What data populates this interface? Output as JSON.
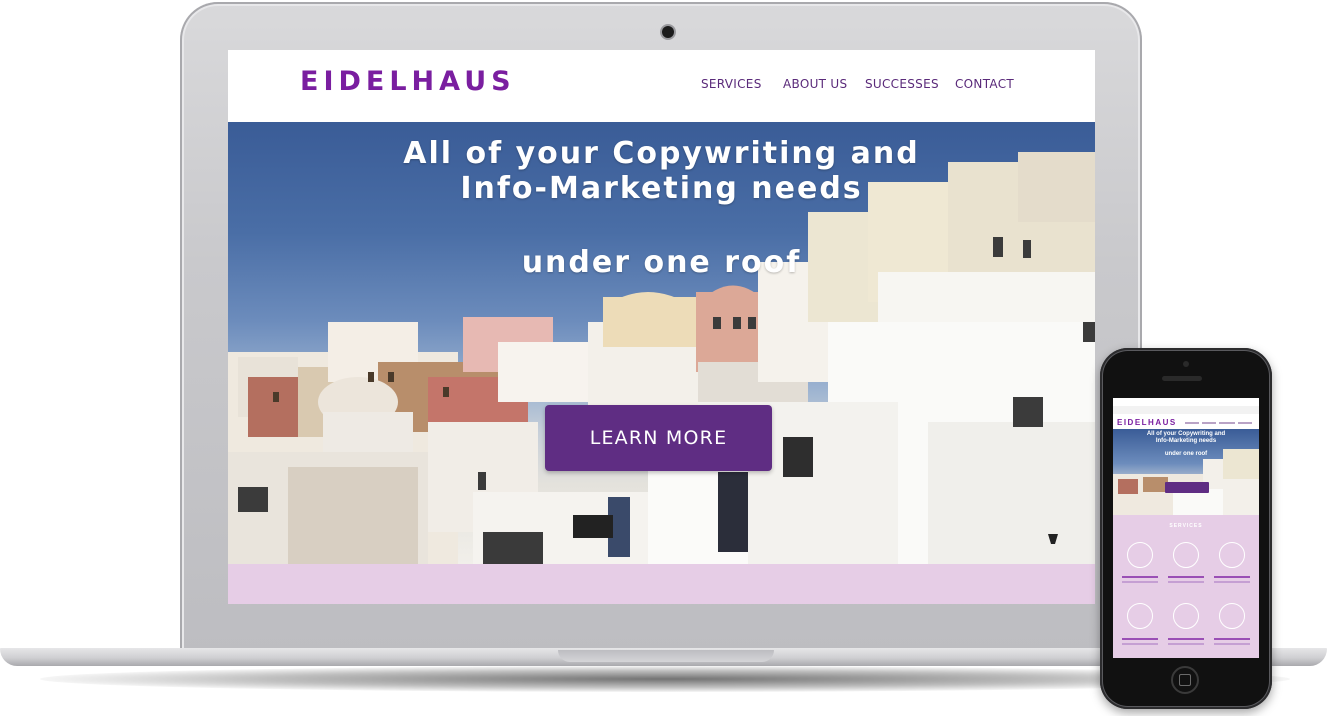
{
  "site": {
    "logo": "EIDELHAUS",
    "nav": [
      {
        "label": "SERVICES"
      },
      {
        "label": "ABOUT US"
      },
      {
        "label": "SUCCESSES"
      },
      {
        "label": "CONTACT"
      }
    ],
    "hero": {
      "headline_line1": "All of your Copywriting and",
      "headline_line2": "Info-Marketing needs",
      "subline": "under one roof",
      "cta_label": "LEARN MORE"
    }
  },
  "phone": {
    "logo": "EIDELHAUS",
    "headline_line1": "All of your Copywriting and",
    "headline_line2": "Info-Marketing needs",
    "subline": "under one roof",
    "section_title": "SERVICES"
  },
  "colors": {
    "brand_purple": "#7a1ea0",
    "cta_purple": "#5f2d83",
    "band_pink": "#e6cde6"
  }
}
